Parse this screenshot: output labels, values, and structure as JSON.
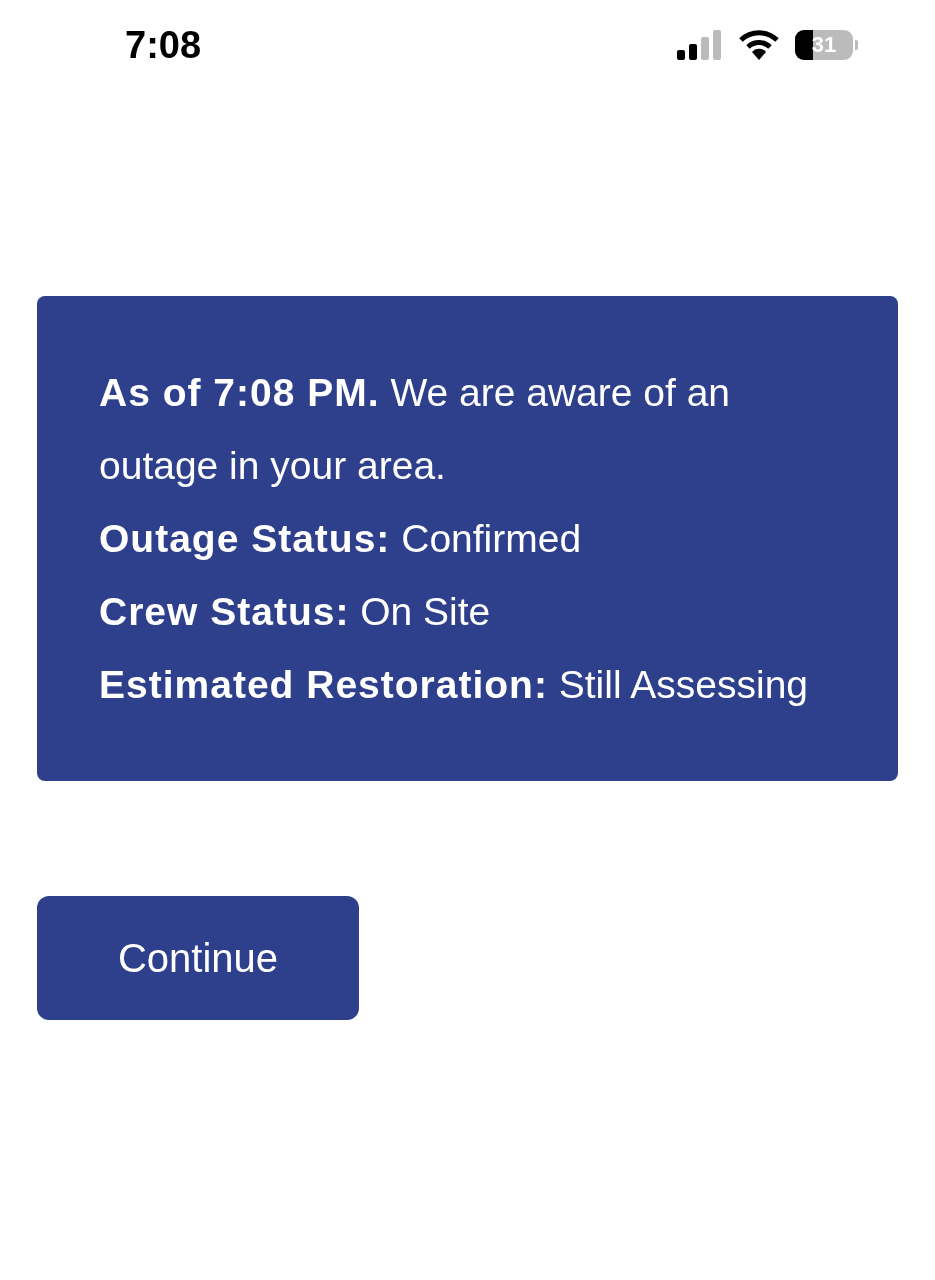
{
  "status_bar": {
    "time": "7:08",
    "battery": "31"
  },
  "notice": {
    "lines": [
      "**As of 7:08 PM.** We are aware of an outage in your area.",
      "**Outage Status:** Confirmed",
      "**Crew Status:** On Site",
      "**Estimated Restoration:** Still Assessing"
    ]
  },
  "buttons": [
    "Continue"
  ]
}
